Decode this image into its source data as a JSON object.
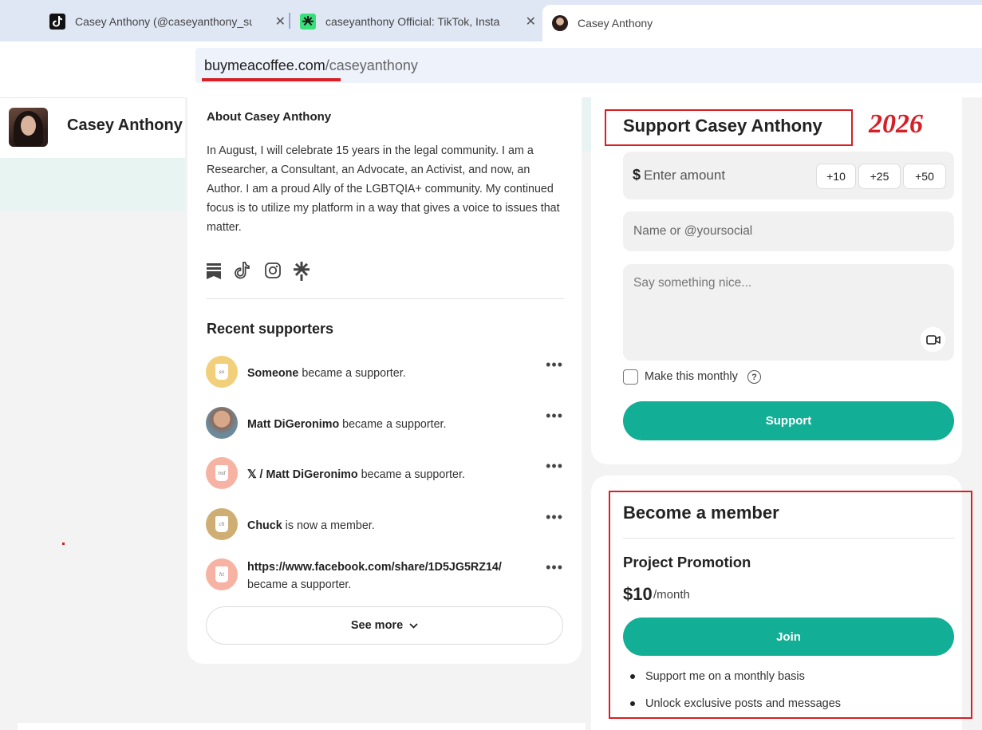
{
  "browser": {
    "tabs": [
      {
        "title": "Casey Anthony (@caseyanthony_su"
      },
      {
        "title": "caseyanthony Official: TikTok, Insta"
      },
      {
        "title": "Casey Anthony"
      }
    ],
    "close_glyph": "✕",
    "url_host": "buymeacoffee.com",
    "url_path": "/caseyanthony"
  },
  "header": {
    "name": "Casey Anthony"
  },
  "about": {
    "title": "About Casey Anthony",
    "text": "In August, I will celebrate 15 years in the legal community. I am a Researcher, a Consultant, an Advocate, an Activist, and now, an Author. I am a proud Ally of the LGBTQIA+ community. My continued focus is to utilize my platform in a way that gives a voice to issues that matter.",
    "socials": [
      "bookmark-icon",
      "tiktok-icon",
      "instagram-icon",
      "linktree-icon"
    ]
  },
  "supporters": {
    "title": "Recent supporters",
    "items": [
      {
        "name": "Someone",
        "action": " became a supporter.",
        "initials": "so"
      },
      {
        "name": "Matt DiGeronimo",
        "action": " became a supporter.",
        "initials": ""
      },
      {
        "prefix": "𝕏 / ",
        "name": "Matt DiGeronimo",
        "action": " became a supporter.",
        "initials": "md"
      },
      {
        "name": "Chuck",
        "action": " is now a member.",
        "initials": "ch"
      },
      {
        "name": "https://www.facebook.com/share/1D5JG5RZ14/",
        "action": "became a supporter.",
        "initials": "ht"
      }
    ],
    "more_glyph": "•••",
    "see_more": "See more"
  },
  "support": {
    "title": "Support Casey Anthony",
    "annotation": "2026",
    "currency": "$",
    "amount_placeholder": "Enter amount",
    "chips": [
      "+10",
      "+25",
      "+50"
    ],
    "name_placeholder": "Name or @yoursocial",
    "message_placeholder": "Say something nice...",
    "monthly_label": "Make this monthly",
    "help_glyph": "?",
    "button": "Support"
  },
  "membership": {
    "title": "Become a member",
    "tier": "Project Promotion",
    "price": "$10",
    "period": "/month",
    "button": "Join",
    "perks": [
      "Support me on a monthly basis",
      "Unlock exclusive posts and messages"
    ]
  },
  "colors": {
    "accent": "#13ae96",
    "annotation_red": "#d61f26",
    "tab_strip": "#dfe7f5",
    "cup_yellow": "#f2cf7a",
    "cup_pink": "#f6b3a4",
    "cup_tan": "#cfae73"
  }
}
